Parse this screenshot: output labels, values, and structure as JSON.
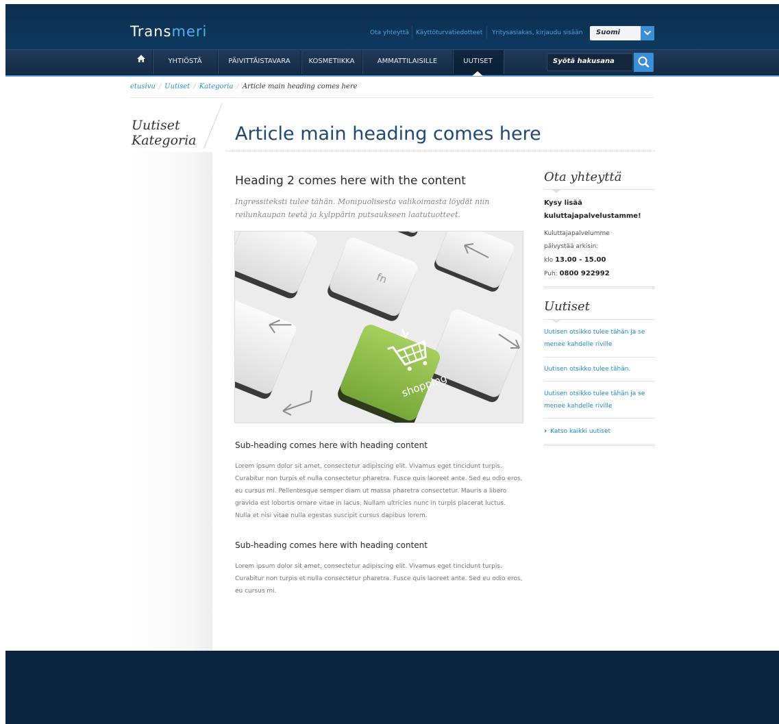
{
  "header": {
    "logo_part1": "Trans",
    "logo_part2": "meri",
    "toplinks": [
      "Ota yhteyttä",
      "Käyttöturvatiedotteet",
      "Yritysasiakas, kirjaudu sisään"
    ],
    "language": "Suomi",
    "search_placeholder": "Syötä hakusana"
  },
  "nav": {
    "items": [
      "YHTIÖSTÄ",
      "PÄIVITTÄISTAVARA",
      "KOSMETIIKKA",
      "AMMATTILAISILLE",
      "UUTISET"
    ],
    "active": "UUTISET"
  },
  "breadcrumb": {
    "items": [
      "etusivu",
      "Uutiset",
      "Kategoria"
    ],
    "current": "Article main heading comes here"
  },
  "section_label": {
    "line1": "Uutiset",
    "line2": "Kategoria"
  },
  "article": {
    "title": "Article main heading comes here",
    "heading2": "Heading 2 comes here with the content",
    "ingress": "Ingressiteksti tulee tähän. Monipuolisesta valikoimasta löydät niin reilunkaupan teetä ja kylppärin putsaukseen laatutuotteet.",
    "image": {
      "key_fn": "fn",
      "key_shopping": "shopping"
    },
    "sections": [
      {
        "subheading": "Sub-heading comes here with heading content",
        "text": "Lorem ipsum dolor sit amet, consectetur adipiscing elit. Vivamus eget tincidunt turpis. Curabitur non turpis et nulla consectetur pharetra. Fusce quis laoreet ante. Sed eu odio eros, eu cursus mi. Pellentesque semper diam ut massa pharetra consectetur. Mauris a libero gravida est lobortis ornare vitae in lacus. Nullam ultricies nunc in turpis placerat luctus. Nulla et nisi vitae nulla egestas suscipit cursus dapibus lorem."
      },
      {
        "subheading": "Sub-heading comes here with heading content",
        "text": "Lorem ipsum dolor sit amet, consectetur adipiscing elit. Vivamus eget tincidunt turpis. Curabitur non turpis et nulla consectetur pharetra. Fusce quis laoreet ante. Sed eu odio eros, eu cursus mi."
      }
    ]
  },
  "sidebar": {
    "contact": {
      "title": "Ota yhteyttä",
      "bold_text": "Kysy lisää kuluttajapalvelustamme!",
      "line1": "Kuluttajapalvelumme",
      "line2": "päivystää arkisin:",
      "hours_prefix": "klo",
      "hours": "13.00 - 15.00",
      "phone_prefix": "Puh:",
      "phone": "0800 922992"
    },
    "news": {
      "title": "Uutiset",
      "items": [
        "Uutisen otsikko tulee tähän ja se menee kahdelle riville",
        "Uutisen otsikko tulee tähän.",
        "Uutisen otsikko tulee tähän ja se menee kahdelle riville"
      ],
      "see_all": "Katso kaikki uutiset"
    }
  },
  "colors": {
    "header_dark": "#0b2c4c",
    "accent_blue": "#3a8fd6",
    "link_blue": "#1f8fd6",
    "title_blue": "#1e4a72",
    "shopping_green": "#8cc04a",
    "footer": "#0a2540"
  }
}
